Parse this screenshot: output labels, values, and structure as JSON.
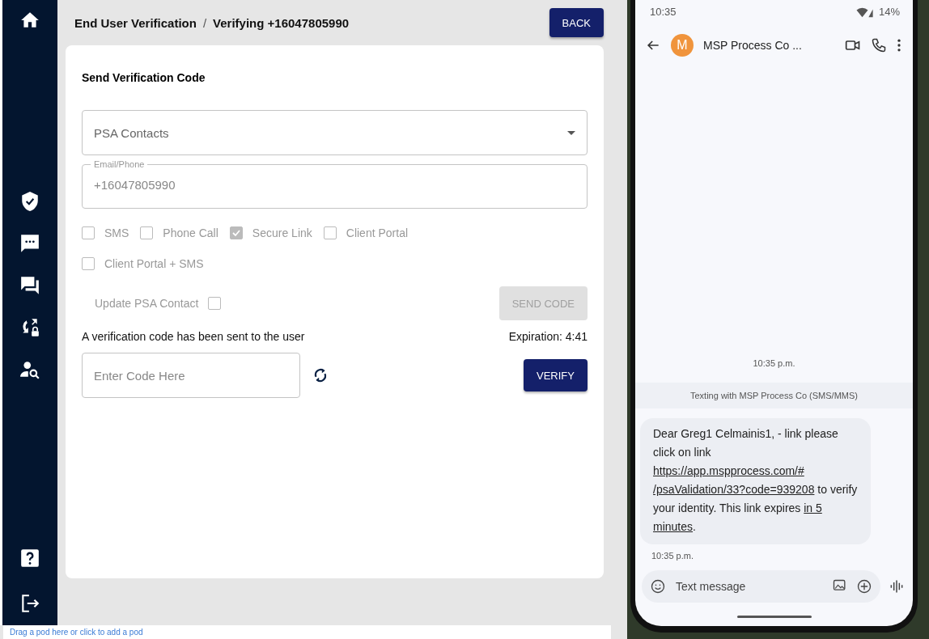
{
  "sidebar": {
    "top_items": [
      {
        "kind": "home"
      }
    ],
    "middle_items": [
      {
        "kind": "shield"
      },
      {
        "kind": "chat"
      },
      {
        "kind": "forum"
      },
      {
        "kind": "lock-sync"
      },
      {
        "kind": "user-search"
      }
    ],
    "bottom_items": [
      {
        "kind": "help"
      },
      {
        "kind": "logout"
      }
    ]
  },
  "header": {
    "breadcrumb": [
      "End User Verification",
      "Verifying +16047805990"
    ],
    "separator": "/",
    "back_button": "BACK"
  },
  "card": {
    "title": "Send Verification Code",
    "contact_select": {
      "value": "PSA Contacts"
    },
    "email_phone": {
      "label": "Email/Phone",
      "value": "+16047805990"
    },
    "methods": [
      {
        "label": "SMS",
        "checked": false
      },
      {
        "label": "Phone Call",
        "checked": false
      },
      {
        "label": "Secure Link",
        "checked": true
      },
      {
        "label": "Client Portal",
        "checked": false
      },
      {
        "label": "Client Portal + SMS",
        "checked": false
      }
    ],
    "update_psa_contact": {
      "label": "Update PSA Contact",
      "checked": false
    },
    "send_code_button": {
      "label": "SEND CODE",
      "disabled": true
    },
    "sent_message": "A verification code has been sent to the user",
    "expiration": "Expiration: 4:41",
    "code_field": {
      "placeholder": "Enter Code Here"
    },
    "verify_button": "VERIFY"
  },
  "pod_bar": "Drag a pod here or click to add a pod",
  "phone": {
    "status_time": "10:35",
    "battery": "14%",
    "contact_initial": "M",
    "contact_name": "MSP Process Co ...",
    "timestamp_top": "10:35 p.m.",
    "thread_info": "Texting with MSP Process Co (SMS/MMS)",
    "message_parts": [
      {
        "text": "Dear Greg1 Celmainis1, - link please click on link ",
        "link": false
      },
      {
        "text": "https://app.mspprocess.com/#",
        "link": true
      },
      {
        "text": "/psaValidation/33?code=939208",
        "link": true
      },
      {
        "text": " to verify your identity. This link expires ",
        "link": false
      },
      {
        "text": "in 5",
        "link": true
      },
      {
        "text": "minutes",
        "link": true
      },
      {
        "text": ".",
        "link": false
      }
    ],
    "message_time": "10:35 p.m.",
    "input_placeholder": "Text message"
  }
}
